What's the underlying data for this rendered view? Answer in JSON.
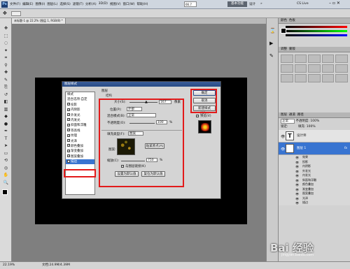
{
  "menu": {
    "ps": "Ps",
    "items": [
      "文件(F)",
      "编辑(E)",
      "图像(I)",
      "图层(L)",
      "选择(S)",
      "滤镜(T)",
      "分析(A)",
      "3D(D)",
      "视图(V)",
      "窗口(W)",
      "帮助(H)"
    ],
    "zoom": "66.7",
    "workspace": "基本功能",
    "design": "设计",
    "more": "»",
    "cslive": "CS Live"
  },
  "tab": {
    "label": "未标题-1 @ 22.2% (图层 1, RGB/8) *"
  },
  "status": {
    "zoom": "22.19%",
    "doc": "文档:24.9M/4.39M"
  },
  "dialog": {
    "title": "图层样式",
    "section_header": "图层",
    "structure": "结构",
    "list": [
      {
        "label": "样式",
        "check": false
      },
      {
        "label": "混合选项:自定",
        "check": false
      },
      {
        "label": "投影",
        "check": true
      },
      {
        "label": "内阴影",
        "check": true
      },
      {
        "label": "外发光",
        "check": true
      },
      {
        "label": "内发光",
        "check": true
      },
      {
        "label": "斜面和浮雕",
        "check": true
      },
      {
        "label": "等高线",
        "check": true
      },
      {
        "label": "纹理",
        "check": true
      },
      {
        "label": "光泽",
        "check": true
      },
      {
        "label": "颜色叠加",
        "check": true
      },
      {
        "label": "渐变叠加",
        "check": true
      },
      {
        "label": "图案叠加",
        "check": true
      },
      {
        "label": "描边",
        "check": true
      }
    ],
    "size_label": "大小(S):",
    "size_value": "167",
    "size_unit": "像素",
    "position_label": "位置(P):",
    "position_value": "外部",
    "blend_label": "混合模式(B):",
    "blend_value": "正常",
    "opacity_label": "不透明度(O):",
    "opacity_value": "100",
    "opacity_unit": "%",
    "filltype_label": "填充类型(F):",
    "filltype_value": "图案",
    "pattern_label": "图案:",
    "snap_btn": "贴紧原点(A)",
    "scale_label": "缩放(C):",
    "scale_value": "750",
    "scale_unit": "%",
    "link_label": "与图层链接(K)",
    "set_default": "设置为默认值",
    "reset_default": "复位为默认值",
    "ok": "确定",
    "cancel": "取消",
    "new_style": "新建样式(W)...",
    "preview": "预览(V)"
  },
  "right": {
    "color_tab": "颜色",
    "swatch_tab": "色板",
    "adjust_tab": "调整",
    "mask_tab": "蒙版",
    "layers_tab": "图层",
    "channels_tab": "通道",
    "paths_tab": "路径",
    "blend_mode": "正常",
    "opacity": "不透明度: 100%",
    "lock": "锁定:",
    "fill": "填充: 100%"
  },
  "layers": [
    {
      "name": "设计师",
      "fx": false
    },
    {
      "name": "图层 1",
      "fx": true
    }
  ],
  "effects": [
    "效果",
    "投影",
    "内阴影",
    "外发光",
    "内发光",
    "斜面和浮雕",
    "颜色叠加",
    "渐变叠加",
    "图案叠加",
    "光泽",
    "描边"
  ],
  "watermark": "Bai 经验",
  "watermark_url": "jingyan.baidu.com"
}
